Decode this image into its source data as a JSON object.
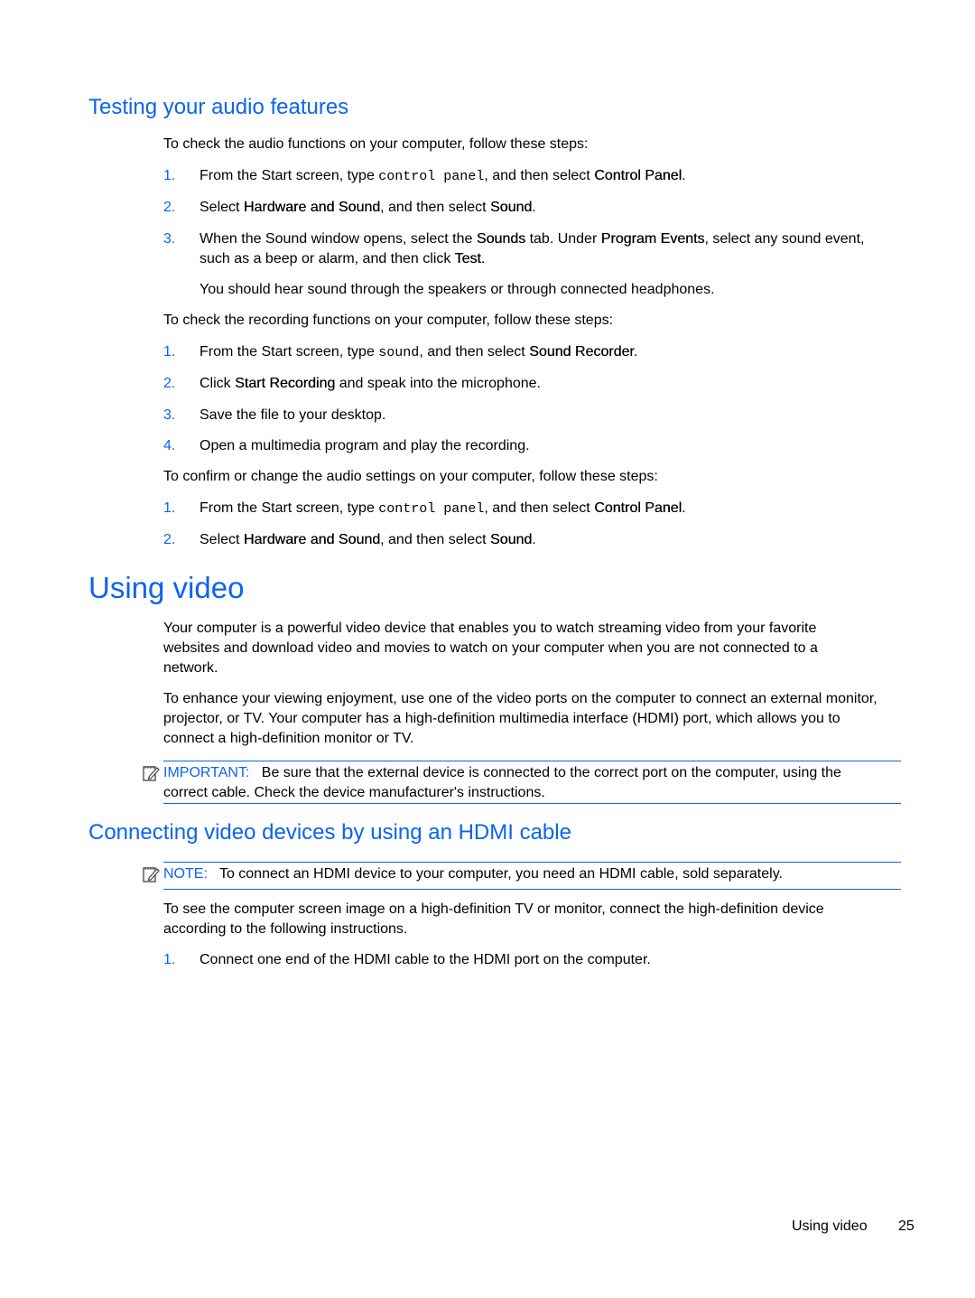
{
  "audio": {
    "heading": "Testing your audio features",
    "intro1": "To check the audio functions on your computer, follow these steps:",
    "steps1": [
      {
        "num": "1.",
        "parts": [
          [
            "From the Start screen, type ",
            ""
          ],
          [
            "control panel",
            "mono"
          ],
          [
            ", and then select ",
            ""
          ],
          [
            "Control Panel",
            "b"
          ],
          [
            ".",
            ""
          ]
        ]
      },
      {
        "num": "2.",
        "parts": [
          [
            "Select ",
            ""
          ],
          [
            "Hardware and Sound",
            "b"
          ],
          [
            ", and then select ",
            ""
          ],
          [
            "Sound",
            "b"
          ],
          [
            ".",
            ""
          ]
        ]
      },
      {
        "num": "3.",
        "parts": [
          [
            "When the Sound window opens, select the ",
            ""
          ],
          [
            "Sounds",
            "b"
          ],
          [
            " tab. Under ",
            ""
          ],
          [
            "Program Events",
            "b"
          ],
          [
            ", select any sound event, such as a beep or alarm, and then click ",
            ""
          ],
          [
            "Test",
            "b"
          ],
          [
            ".",
            ""
          ]
        ]
      }
    ],
    "step3_followup": "You should hear sound through the speakers or through connected headphones.",
    "intro2": "To check the recording functions on your computer, follow these steps:",
    "steps2": [
      {
        "num": "1.",
        "parts": [
          [
            "From the Start screen, type ",
            ""
          ],
          [
            "sound",
            "mono"
          ],
          [
            ", and then select ",
            ""
          ],
          [
            "Sound Recorder",
            "b"
          ],
          [
            ".",
            ""
          ]
        ]
      },
      {
        "num": "2.",
        "parts": [
          [
            "Click ",
            ""
          ],
          [
            "Start Recording",
            "b"
          ],
          [
            " and speak into the microphone.",
            ""
          ]
        ]
      },
      {
        "num": "3.",
        "parts": [
          [
            "Save the file to your desktop.",
            ""
          ]
        ]
      },
      {
        "num": "4.",
        "parts": [
          [
            "Open a multimedia program and play the recording.",
            ""
          ]
        ]
      }
    ],
    "intro3": "To confirm or change the audio settings on your computer, follow these steps:",
    "steps3": [
      {
        "num": "1.",
        "parts": [
          [
            "From the Start screen, type ",
            ""
          ],
          [
            "control panel",
            "mono"
          ],
          [
            ", and then select ",
            ""
          ],
          [
            "Control Panel",
            "b"
          ],
          [
            ".",
            ""
          ]
        ]
      },
      {
        "num": "2.",
        "parts": [
          [
            "Select ",
            ""
          ],
          [
            "Hardware and Sound",
            "b"
          ],
          [
            ", and then select ",
            ""
          ],
          [
            "Sound",
            "b"
          ],
          [
            ".",
            ""
          ]
        ]
      }
    ]
  },
  "video": {
    "heading": "Using video",
    "para1": "Your computer is a powerful video device that enables you to watch streaming video from your favorite websites and download video and movies to watch on your computer when you are not connected to a network.",
    "para2": "To enhance your viewing enjoyment, use one of the video ports on the computer to connect an external monitor, projector, or TV. Your computer has a high-definition multimedia interface (HDMI) port, which allows you to connect a high-definition monitor or TV.",
    "important_label": "IMPORTANT:",
    "important_text": "Be sure that the external device is connected to the correct port on the computer, using the correct cable. Check the device manufacturer's instructions."
  },
  "hdmi": {
    "heading": "Connecting video devices by using an HDMI cable",
    "note_label": "NOTE:",
    "note_text": "To connect an HDMI device to your computer, you need an HDMI cable, sold separately.",
    "para1": "To see the computer screen image on a high-definition TV or monitor, connect the high-definition device according to the following instructions.",
    "steps": [
      {
        "num": "1.",
        "parts": [
          [
            "Connect one end of the HDMI cable to the HDMI port on the computer.",
            ""
          ]
        ]
      }
    ]
  },
  "footer": {
    "section": "Using video",
    "page": "25"
  },
  "colors": {
    "accent": "#0a64f0"
  }
}
